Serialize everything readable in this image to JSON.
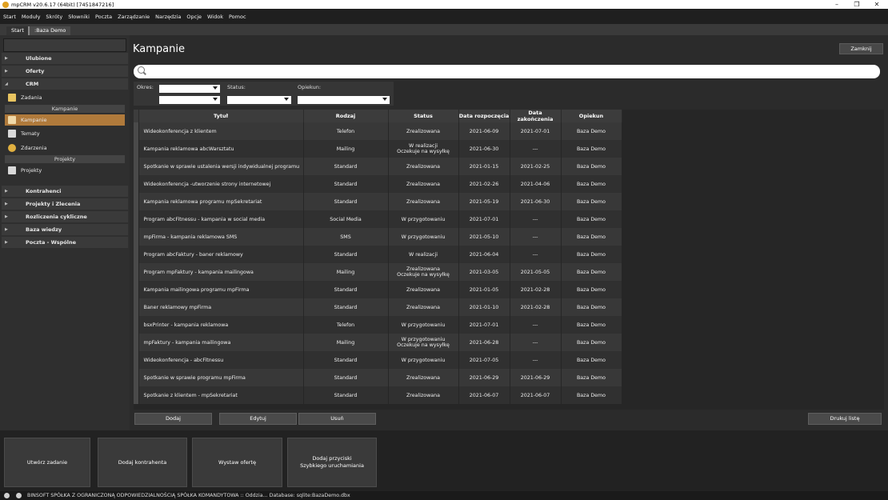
{
  "window": {
    "title": "mpCRM v20.6.17 (64bit) [7451847216]",
    "minimize": "–",
    "maximize": "❐",
    "close": "✕"
  },
  "menu": [
    "Start",
    "Moduły",
    "Skróty",
    "Słowniki",
    "Poczta",
    "Zarządzanie",
    "Narzędzia",
    "Opcje",
    "Widok",
    "Pomoc"
  ],
  "tabs": {
    "start": "Start",
    "active": ":Baza Demo"
  },
  "sidebar": {
    "ulubione": "Ulubione",
    "oferty": "Oferty",
    "crm": "CRM",
    "zadania": "Zadania",
    "group_kampanie": "Kampanie",
    "kampanie": "Kampanie",
    "tematy": "Tematy",
    "zdarzenia": "Zdarzenia",
    "group_projekty": "Projekty",
    "projekty": "Projekty",
    "kontrahenci": "Kontrahenci",
    "projekty_zlecenia": "Projekty i Zlecenia",
    "rozliczenia": "Rozliczenia cykliczne",
    "baza_wiedzy": "Baza wiedzy",
    "poczta": "Poczta - Wspólne"
  },
  "main": {
    "title": "Kampanie",
    "close_button": "Zamknij",
    "filters": {
      "okres": "Okres:",
      "status": "Status:",
      "opiekun": "Opiekun:"
    },
    "columns": [
      "Tytuł",
      "Rodzaj",
      "Status",
      "Data rozpoczęcia",
      "Data zakończenia",
      "Opiekun"
    ],
    "rows": [
      [
        "Wideokonferencja z klientem",
        "Telefon",
        "Zrealizowana",
        "",
        "2021-06-09",
        "2021-07-01",
        "Baza Demo"
      ],
      [
        "Kampania reklamowa abcWarsztatu",
        "Mailing",
        "W realizacji",
        "Oczekuje na wysyłkę",
        "2021-06-30",
        "---",
        "Baza Demo"
      ],
      [
        "Spotkanie w sprawie ustalenia wersji indywidualnej programu",
        "Standard",
        "Zrealizowana",
        "",
        "2021-01-15",
        "2021-02-25",
        "Baza Demo"
      ],
      [
        "Wideokonferencja -utworzenie strony internetowej",
        "Standard",
        "Zrealizowana",
        "",
        "2021-02-26",
        "2021-04-06",
        "Baza Demo"
      ],
      [
        "Kampania reklamowa programu mpSekretariat",
        "Standard",
        "Zrealizowana",
        "",
        "2021-05-19",
        "2021-06-30",
        "Baza Demo"
      ],
      [
        "Program abcFitnessu - kampania w social media",
        "Social Media",
        "W przygotowaniu",
        "",
        "2021-07-01",
        "---",
        "Baza Demo"
      ],
      [
        "mpFirma - kampania reklamowa SMS",
        "SMS",
        "W przygotowaniu",
        "",
        "2021-05-10",
        "---",
        "Baza Demo"
      ],
      [
        "Program abcFaktury - baner reklamowy",
        "Standard",
        "W realizacji",
        "",
        "2021-06-04",
        "---",
        "Baza Demo"
      ],
      [
        "Program mpFaktury - kampania mailingowa",
        "Mailing",
        "Zrealizowana",
        "Oczekuje na wysyłkę",
        "2021-03-05",
        "2021-05-05",
        "Baza Demo"
      ],
      [
        "Kampania mailingowa programu mpFirma",
        "Standard",
        "Zrealizowana",
        "",
        "2021-01-05",
        "2021-02-28",
        "Baza Demo"
      ],
      [
        "Baner reklamowy mpFirma",
        "Standard",
        "Zrealizowana",
        "",
        "2021-01-10",
        "2021-02-28",
        "Baza Demo"
      ],
      [
        "bsxPrinter - kampania reklamowa",
        "Telefon",
        "W przygotowaniu",
        "",
        "2021-07-01",
        "---",
        "Baza Demo"
      ],
      [
        "mpFaktury - kampania mailingowa",
        "Mailing",
        "W przygotowaniu",
        "Oczekuje na wysyłkę",
        "2021-06-28",
        "---",
        "Baza Demo"
      ],
      [
        "Wideokonferencja - abcFitnessu",
        "Standard",
        "W przygotowaniu",
        "",
        "2021-07-05",
        "---",
        "Baza Demo"
      ],
      [
        "Spotkanie w sprawie programu mpFirma",
        "Standard",
        "Zrealizowana",
        "",
        "2021-06-29",
        "2021-06-29",
        "Baza Demo"
      ],
      [
        "Spotkanie z klientem - mpSekretariat",
        "Standard",
        "Zrealizowana",
        "",
        "2021-06-07",
        "2021-06-07",
        "Baza Demo"
      ]
    ],
    "buttons": {
      "dodaj": "Dodaj",
      "edytuj": "Edytuj",
      "usun": "Usuń",
      "drukuj": "Drukuj listę"
    }
  },
  "quick": {
    "utworz_zadanie": "Utwórz zadanie",
    "dodaj_kontrahenta": "Dodaj kontrahenta",
    "wystaw_oferte": "Wystaw ofertę",
    "dodaj_przyciski_1": "Dodaj przyciski",
    "dodaj_przyciski_2": "Szybkiego uruchamiania"
  },
  "status_bar": {
    "text": "BINSOFT SPÓŁKA Z OGRANICZONĄ ODPOWIEDZIALNOŚCIĄ SPÓŁKA KOMANDYTOWA :: Oddzia... Database: sqlite:BazaDemo.dbx"
  }
}
